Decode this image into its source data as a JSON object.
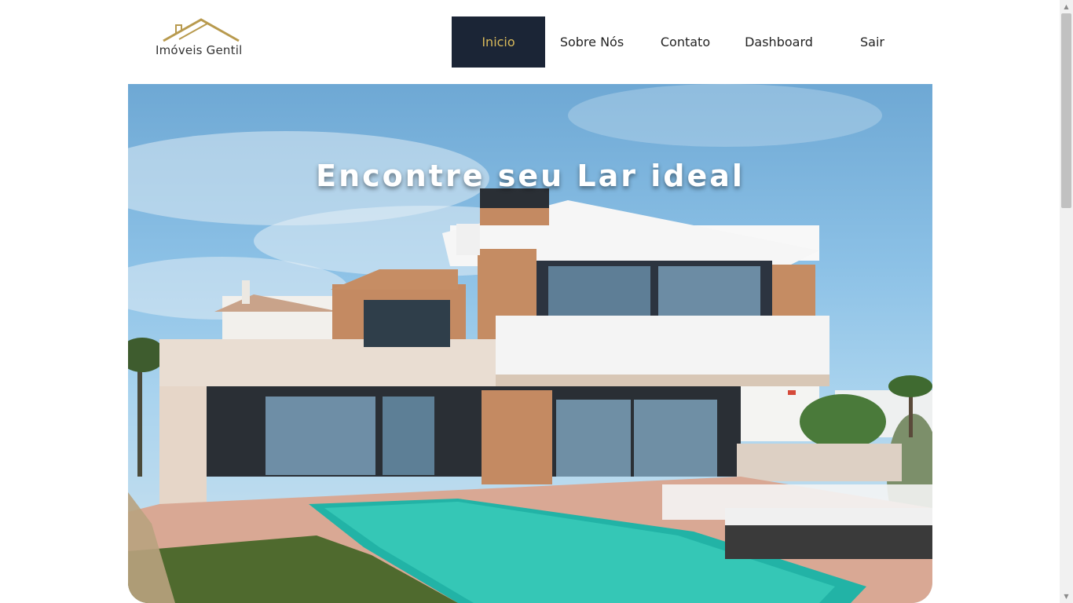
{
  "brand": {
    "name": "Imóveis Gentil",
    "logo_color": "#b89a4e",
    "text_color": "#333333"
  },
  "nav": {
    "items": [
      {
        "label": "Inicio",
        "active": true
      },
      {
        "label": "Sobre Nós",
        "active": false
      },
      {
        "label": "Contato",
        "active": false
      },
      {
        "label": "Dashboard",
        "active": false
      },
      {
        "label": "Sair",
        "active": false
      }
    ],
    "active_bg": "#1b2536",
    "active_color": "#d8b95a"
  },
  "hero": {
    "title": "Encontre seu Lar ideal",
    "image": "modern-house-with-pool"
  },
  "scrollbar": {
    "up_icon": "arrow-up-icon",
    "down_icon": "arrow-down-icon"
  }
}
